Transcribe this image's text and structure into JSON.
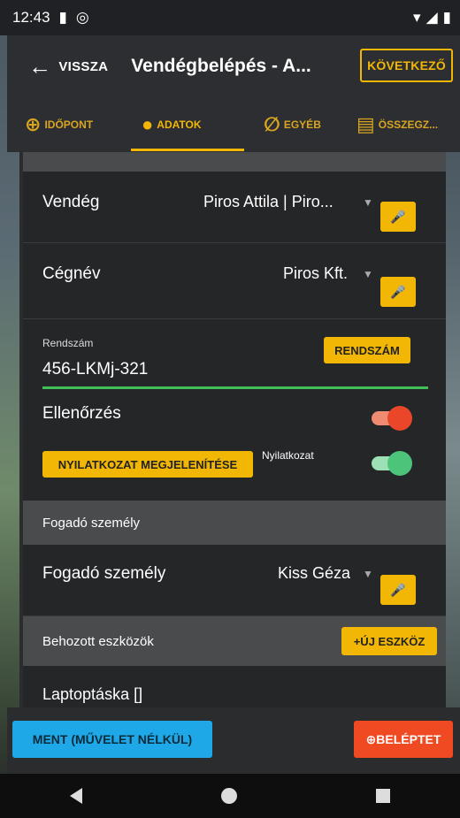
{
  "status": {
    "time": "12:43"
  },
  "header": {
    "back_label": "VISSZA",
    "title": "Vendégbelépés - A...",
    "next_label": "KÖVETKEZŐ"
  },
  "tabs": [
    {
      "label": "IDŐPONT",
      "icon": "arrow-in-circle-icon"
    },
    {
      "label": "ADATOK",
      "icon": "person-icon",
      "active": true
    },
    {
      "label": "EGYÉB",
      "icon": "paperclip-icon"
    },
    {
      "label": "ÖSSZEGZ...",
      "icon": "summary-icon"
    }
  ],
  "form": {
    "guest": {
      "label": "Vendég",
      "value": "Piros Attila | Piro..."
    },
    "company": {
      "label": "Cégnév",
      "value": "Piros Kft."
    },
    "plate": {
      "label": "Rendszám",
      "value": "456-LKMj-321",
      "button": "RENDSZÁM"
    },
    "check": {
      "label": "Ellenőrzés",
      "on": true
    },
    "declaration": {
      "button": "NYILATKOZAT MEGJELENÍTÉSE",
      "label": "Nyilatkozat",
      "on": true
    },
    "host_section": "Fogadó személy",
    "host": {
      "label": "Fogadó személy",
      "value": "Kiss Géza"
    },
    "devices_section": "Behozott eszközök",
    "new_device_button": "+ÚJ ESZKÖZ",
    "device_item": "Laptoptáska []"
  },
  "footer": {
    "save_label": "MENT (MŰVELET NÉLKÜL)",
    "enter_label": "BELÉPTET"
  },
  "colors": {
    "accent": "#f2b705",
    "save": "#1ea8e7",
    "enter": "#f04a23",
    "underline": "#3fbf57",
    "switch_red": "#e9462a",
    "switch_green": "#4cc47a"
  }
}
